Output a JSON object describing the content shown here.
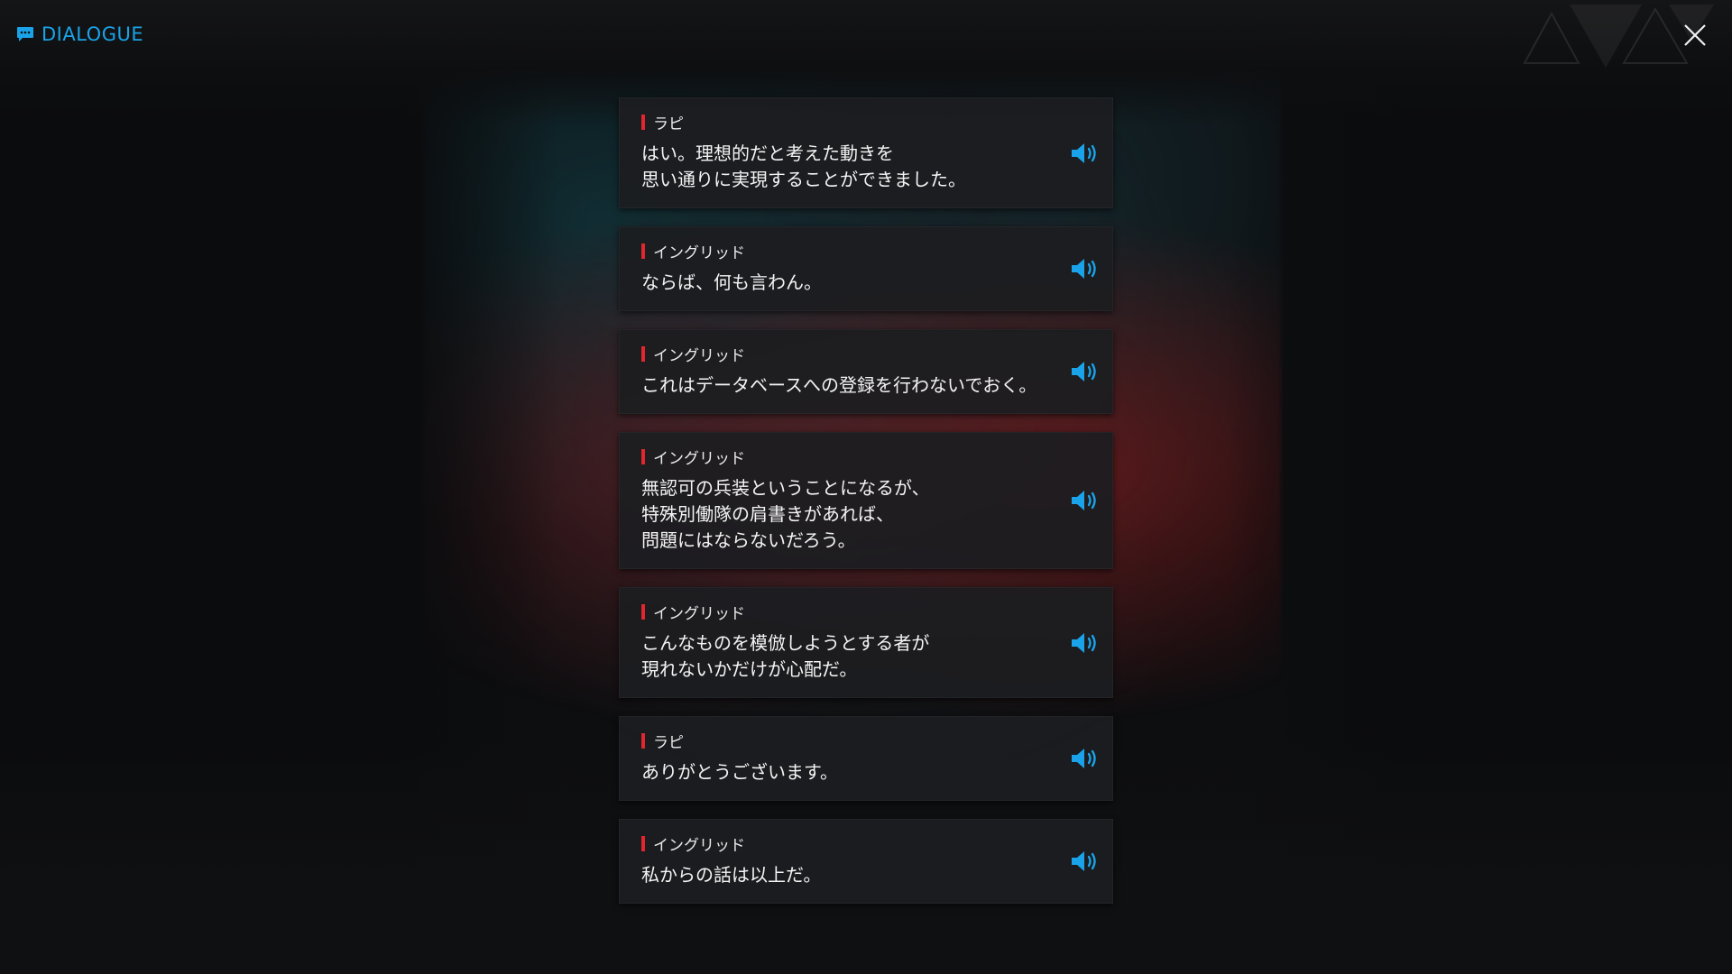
{
  "header": {
    "title": "DIALOGUE",
    "accent_color": "#1aa3e8",
    "icon": "chat-bubble-icon",
    "close_icon": "close-icon"
  },
  "colors": {
    "speaker_marker": "#e2262d",
    "voice_icon": "#1aa3e8"
  },
  "dialogue": [
    {
      "speaker": "ラピ",
      "text": "はい。理想的だと考えた動きを\n思い通りに実現することができました。"
    },
    {
      "speaker": "イングリッド",
      "text": "ならば、何も言わん。"
    },
    {
      "speaker": "イングリッド",
      "text": "これはデータベースへの登録を行わないでおく。"
    },
    {
      "speaker": "イングリッド",
      "text": "無認可の兵装ということになるが、\n特殊別働隊の肩書きがあれば、\n問題にはならないだろう。"
    },
    {
      "speaker": "イングリッド",
      "text": "こんなものを模倣しようとする者が\n現れないかだけが心配だ。"
    },
    {
      "speaker": "ラピ",
      "text": "ありがとうございます。"
    },
    {
      "speaker": "イングリッド",
      "text": "私からの話は以上だ。"
    }
  ]
}
